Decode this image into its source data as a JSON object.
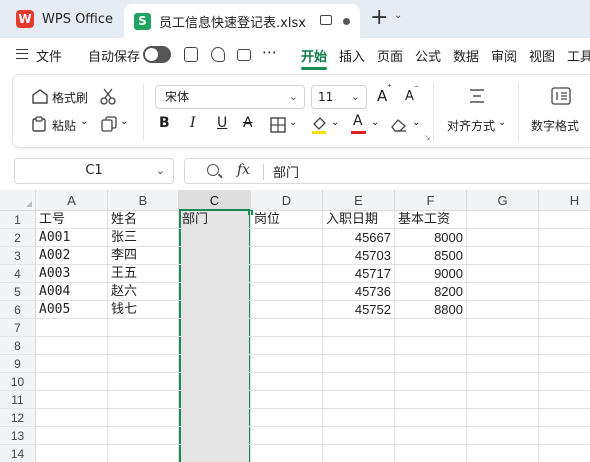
{
  "titlebar": {
    "app_tab": "WPS Office",
    "app_logo": "W",
    "file_tab": "员工信息快速登记表.xlsx",
    "file_logo": "S",
    "new_tab": "+",
    "new_tab_chevron": "⌄"
  },
  "menubar": {
    "file": "文件",
    "autosave": "自动保存",
    "more": "⋯",
    "tabs": [
      "开始",
      "插入",
      "页面",
      "公式",
      "数据",
      "审阅",
      "视图",
      "工具"
    ],
    "active_tab": "开始"
  },
  "ribbon": {
    "format_painter": "格式刷",
    "paste": "粘贴",
    "font_name": "宋体",
    "font_size": "11",
    "align": "对齐方式",
    "number_format": "数字格式",
    "bold": "B",
    "italic": "I",
    "underline": "U",
    "strike": "A",
    "grow": "A",
    "shrink": "A",
    "chevron": "⌄",
    "colors": {
      "highlight": "#f5e000",
      "font_color": "#e02020",
      "accent": "#1a8b55"
    }
  },
  "formulabar": {
    "cell_ref": "C1",
    "fx": "fx",
    "value": "部门"
  },
  "sheet": {
    "columns": [
      "A",
      "B",
      "C",
      "D",
      "E",
      "F",
      "G",
      "H"
    ],
    "selected_column": "C",
    "row_numbers": [
      "1",
      "2",
      "3",
      "4",
      "5",
      "6",
      "7",
      "8",
      "9",
      "10",
      "11",
      "12",
      "13",
      "14"
    ],
    "headers": [
      "工号",
      "姓名",
      "部门",
      "岗位",
      "入职日期",
      "基本工资"
    ],
    "rows": [
      [
        "A001",
        "张三",
        "",
        "",
        "45667",
        "8000"
      ],
      [
        "A002",
        "李四",
        "",
        "",
        "45703",
        "8500"
      ],
      [
        "A003",
        "王五",
        "",
        "",
        "45717",
        "9000"
      ],
      [
        "A004",
        "赵六",
        "",
        "",
        "45736",
        "8200"
      ],
      [
        "A005",
        "钱七",
        "",
        "",
        "45752",
        "8800"
      ]
    ]
  }
}
